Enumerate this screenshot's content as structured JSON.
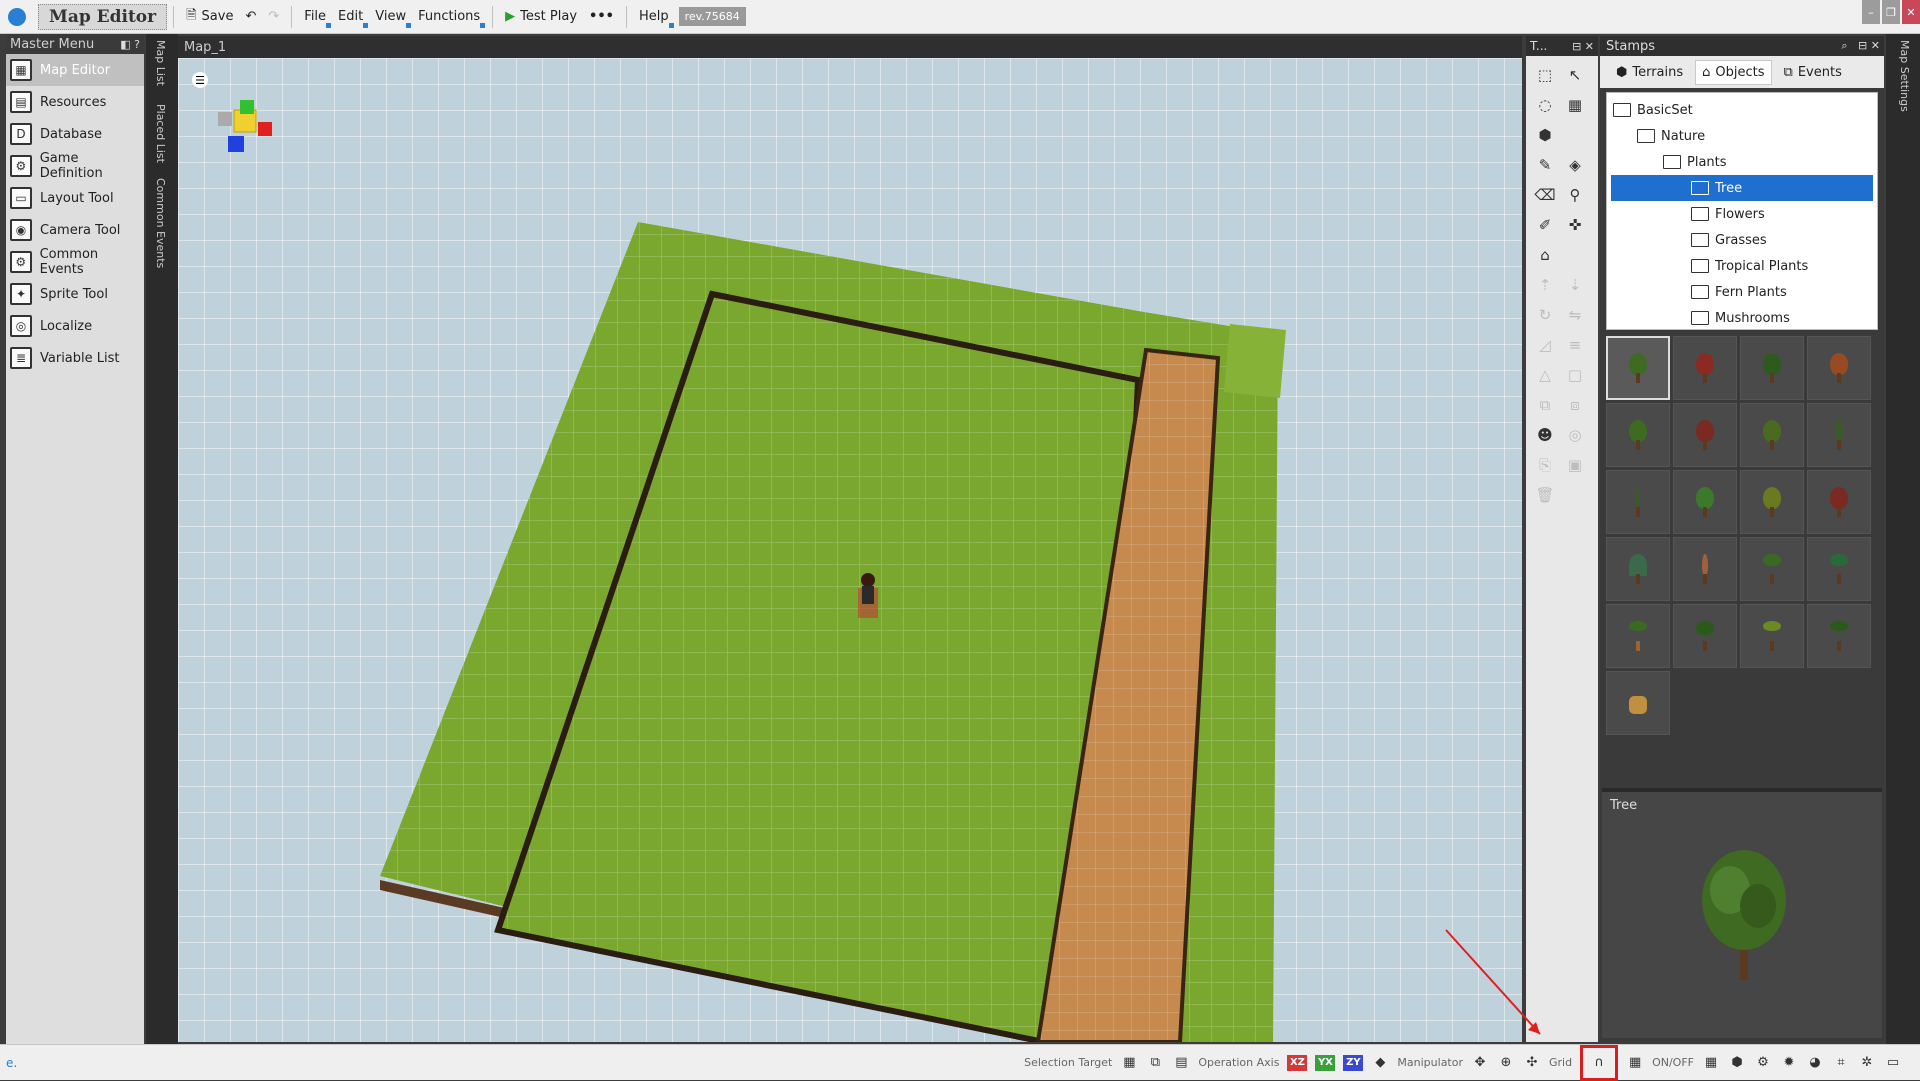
{
  "titlebar": {
    "app_title": "Map Editor",
    "save_label": "Save",
    "menus": [
      "File",
      "Edit",
      "View",
      "Functions"
    ],
    "test_play_label": "Test Play",
    "help_label": "Help",
    "revision": "rev.75684"
  },
  "master_menu": {
    "title": "Master Menu",
    "items": [
      {
        "label": "Map Editor",
        "icon": "map-icon",
        "active": true
      },
      {
        "label": "Resources",
        "icon": "resources-icon"
      },
      {
        "label": "Database",
        "icon": "database-icon"
      },
      {
        "label": "Game Definition",
        "icon": "game-definition-icon"
      },
      {
        "label": "Layout Tool",
        "icon": "layout-icon"
      },
      {
        "label": "Camera Tool",
        "icon": "camera-icon"
      },
      {
        "label": "Common Events",
        "icon": "common-events-icon"
      },
      {
        "label": "Sprite Tool",
        "icon": "sprite-icon"
      },
      {
        "label": "Localize",
        "icon": "localize-icon"
      },
      {
        "label": "Variable List",
        "icon": "variable-list-icon"
      }
    ]
  },
  "side_tabs": [
    "Map List",
    "Placed List",
    "Common Events"
  ],
  "viewport": {
    "tab_label": "Map_1"
  },
  "tools_panel": {
    "title": "T..."
  },
  "stamps": {
    "title": "Stamps",
    "tabs": [
      "Terrains",
      "Objects",
      "Events"
    ],
    "active_tab": "Objects",
    "tree": [
      {
        "label": "BasicSet",
        "depth": 0
      },
      {
        "label": "Nature",
        "depth": 1
      },
      {
        "label": "Plants",
        "depth": 2
      },
      {
        "label": "Tree",
        "depth": 3,
        "selected": true
      },
      {
        "label": "Flowers",
        "depth": 3
      },
      {
        "label": "Grasses",
        "depth": 3
      },
      {
        "label": "Tropical Plants",
        "depth": 3
      },
      {
        "label": "Fern Plants",
        "depth": 3
      },
      {
        "label": "Mushrooms",
        "depth": 3
      }
    ],
    "preview_title": "Tree"
  },
  "right_strip_label": "Map Settings",
  "statusbar": {
    "left_text": "e.",
    "selection_target_label": "Selection Target",
    "operation_axis_label": "Operation Axis",
    "axis_buttons": [
      "XZ",
      "YX",
      "ZY"
    ],
    "manipulator_label": "Manipulator",
    "grid_label": "Grid",
    "onoff_label": "ON/OFF",
    "colors": {
      "xz": "#d03a3a",
      "yx": "#3aa03a",
      "zy": "#3a4ad0"
    }
  }
}
